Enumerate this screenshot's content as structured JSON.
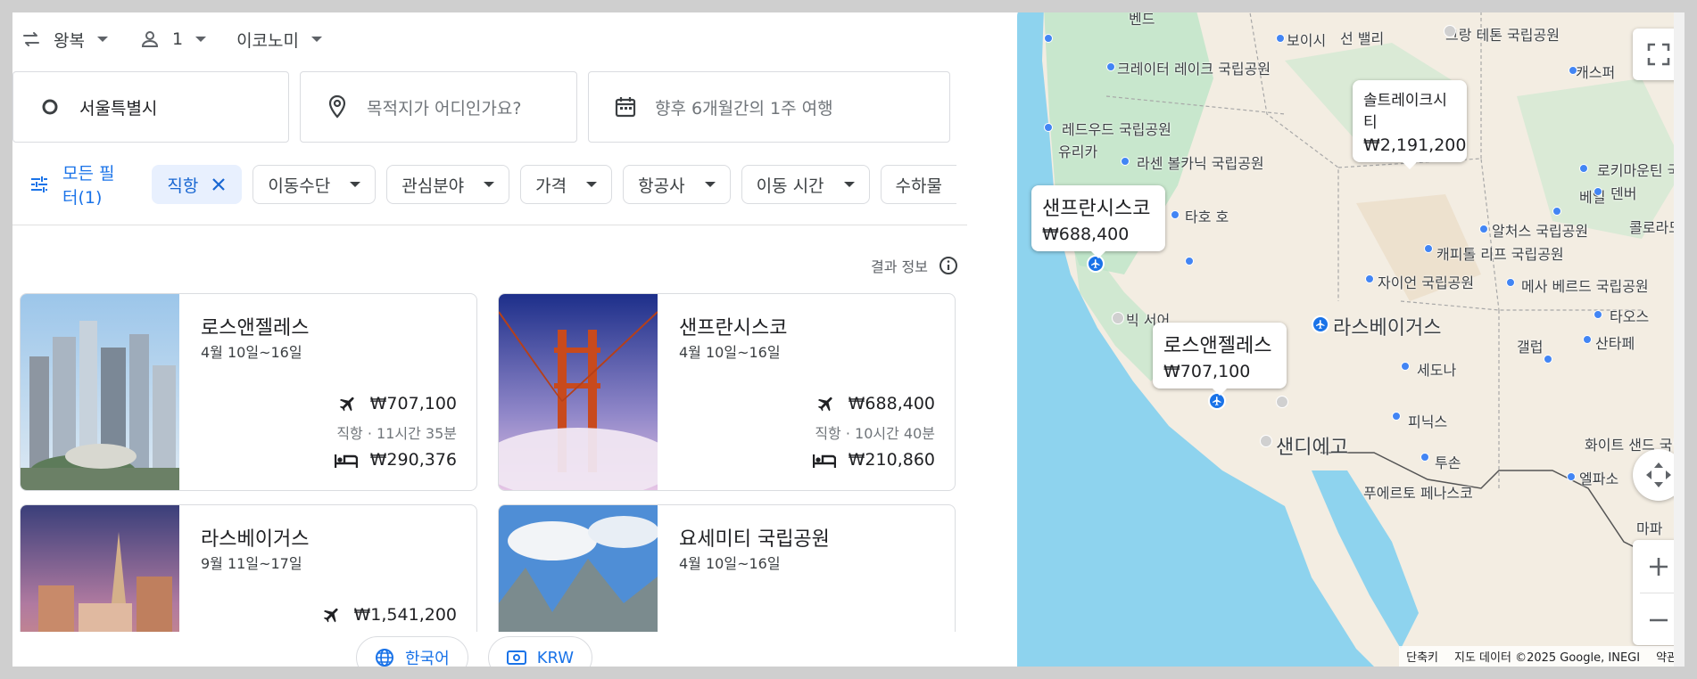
{
  "topbar": {
    "trip_type": "왕복",
    "passengers": "1",
    "cabin": "이코노미"
  },
  "search": {
    "origin": "서울특별시",
    "destination_placeholder": "목적지가 어디인가요?",
    "dates_placeholder": "향후 6개월간의 1주 여행"
  },
  "filters": {
    "all_filters": "모든 필터(1)",
    "active_chip": "직항",
    "chips": [
      "이동수단",
      "관심분야",
      "가격",
      "항공사",
      "이동 시간"
    ],
    "cut_chip": "수하물"
  },
  "results_info": "결과 정보",
  "cards": [
    {
      "title": "로스앤젤레스",
      "dates": "4월 10일~16일",
      "flight_price": "₩707,100",
      "flight_sub": "직항 · 11시간 35분",
      "hotel_price": "₩290,376"
    },
    {
      "title": "샌프란시스코",
      "dates": "4월 10일~16일",
      "flight_price": "₩688,400",
      "flight_sub": "직항 · 10시간 40분",
      "hotel_price": "₩210,860"
    },
    {
      "title": "라스베이거스",
      "dates": "9월 11일~17일",
      "flight_price": "₩1,541,200"
    },
    {
      "title": "요세미티 국립공원",
      "dates": "4월 10일~16일"
    }
  ],
  "footer": {
    "language": "한국어",
    "currency": "KRW"
  },
  "map": {
    "callouts": [
      {
        "name": "샌프란시스코",
        "price": "₩688,400"
      },
      {
        "name": "로스앤젤레스",
        "price": "₩707,100"
      },
      {
        "name": "솔트레이크시티",
        "price": "₩2,191,200"
      }
    ],
    "labels": [
      "벤드",
      "보이시",
      "선 밸리",
      "그랑 테톤 국립공원",
      "크레이터 레이크 국립공원",
      "캐스퍼",
      "레드우드 국립공원",
      "유리카",
      "라센 볼카닉 국립공원",
      "로키마운틴 국립공원",
      "베일",
      "덴버",
      "타호 호",
      "알처스 국립공원",
      "콜로라도스",
      "캐피톨 리프 국립공원",
      "자이언 국립공원",
      "메사 베르드 국립공원",
      "타오스",
      "빅 서어",
      "갤럽",
      "산타페",
      "세도나",
      "피닉스",
      "투손",
      "화이트 샌드 국립",
      "엘파소",
      "푸에르토 페나스코",
      "마파"
    ],
    "big_labels": [
      "라스베이거스",
      "샌디에고"
    ],
    "attribution": [
      "단축키",
      "지도 데이터 ©2025 Google, INEGI",
      "약관"
    ]
  }
}
